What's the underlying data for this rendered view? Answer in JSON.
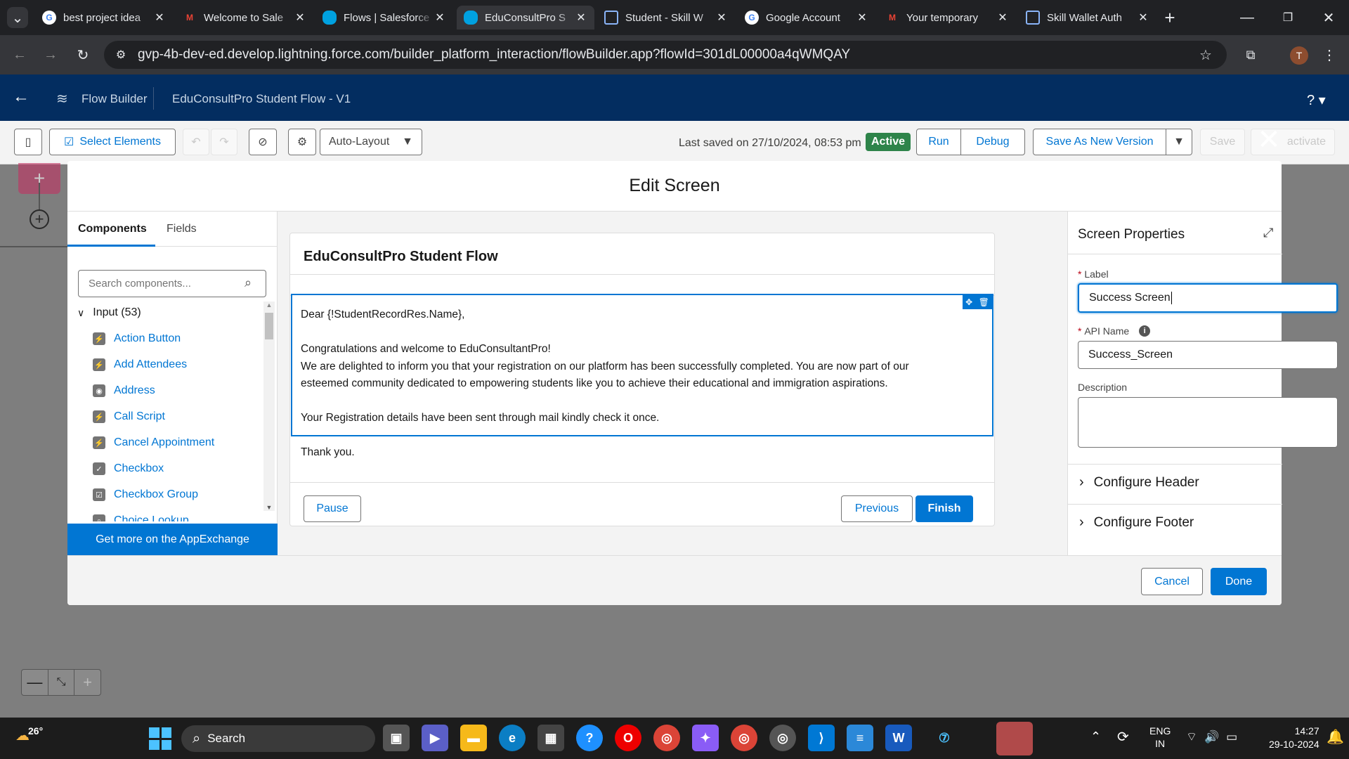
{
  "browser": {
    "tabs": [
      {
        "title": "best project idea",
        "icon": "google-icon"
      },
      {
        "title": "Welcome to Sale",
        "icon": "gmail-icon"
      },
      {
        "title": "Flows | Salesforce",
        "icon": "salesforce-icon"
      },
      {
        "title": "EduConsultPro S",
        "icon": "salesforce-icon"
      },
      {
        "title": "Student - Skill W",
        "icon": "page-icon"
      },
      {
        "title": "Google Account",
        "icon": "google-icon"
      },
      {
        "title": "Your temporary",
        "icon": "gmail-icon"
      },
      {
        "title": "Skill Wallet Auth",
        "icon": "page-icon"
      }
    ],
    "url": "gvp-4b-dev-ed.develop.lightning.force.com/builder_platform_interaction/flowBuilder.app?flowId=301dL00000a4qWMQAY",
    "profile_initial": "T"
  },
  "header": {
    "app_name": "Flow Builder",
    "flow_title": "EduConsultPro Student Flow - V1",
    "help": "?"
  },
  "toolbar": {
    "select_elements": "Select Elements",
    "layout": "Auto-Layout",
    "last_saved": "Last saved on 27/10/2024, 08:53 pm",
    "status": "Active",
    "run": "Run",
    "debug": "Debug",
    "save_new_version": "Save As New Version",
    "save": "Save",
    "deactivate": "activate"
  },
  "modal": {
    "title": "Edit Screen",
    "left_tabs": {
      "components": "Components",
      "fields": "Fields"
    },
    "search_placeholder": "Search components...",
    "section": "Input (53)",
    "components": [
      "Action Button",
      "Add Attendees",
      "Address",
      "Call Script",
      "Cancel Appointment",
      "Checkbox",
      "Checkbox Group",
      "Choice Lookup"
    ],
    "appexchange": "Get more on the AppExchange",
    "screen_header": "EduConsultPro Student Flow",
    "body_lines": [
      "Dear {!StudentRecordRes.Name},",
      "",
      "Congratulations and welcome to EduConsultantPro!",
      "We are delighted to inform you that your registration on our platform has been successfully completed. You are now part of our",
      "esteemed community dedicated to empowering students like you to achieve their educational and immigration aspirations.",
      "",
      "Your Registration details have been sent through mail kindly check it once.",
      "",
      "Thank you."
    ],
    "pause": "Pause",
    "previous": "Previous",
    "finish": "Finish",
    "props": {
      "title": "Screen Properties",
      "label_label": "Label",
      "label_value": "Success Screen",
      "api_label": "API Name",
      "api_value": "Success_Screen",
      "desc_label": "Description",
      "configure_header": "Configure Header",
      "configure_footer": "Configure Footer"
    },
    "cancel": "Cancel",
    "done": "Done"
  },
  "taskbar": {
    "weather": "26°",
    "search": "Search",
    "lang": "ENG",
    "region": "IN",
    "time": "14:27",
    "date": "29-10-2024"
  },
  "colors": {
    "brand": "#0176d3",
    "header": "#032d60",
    "active": "#2e844a"
  }
}
